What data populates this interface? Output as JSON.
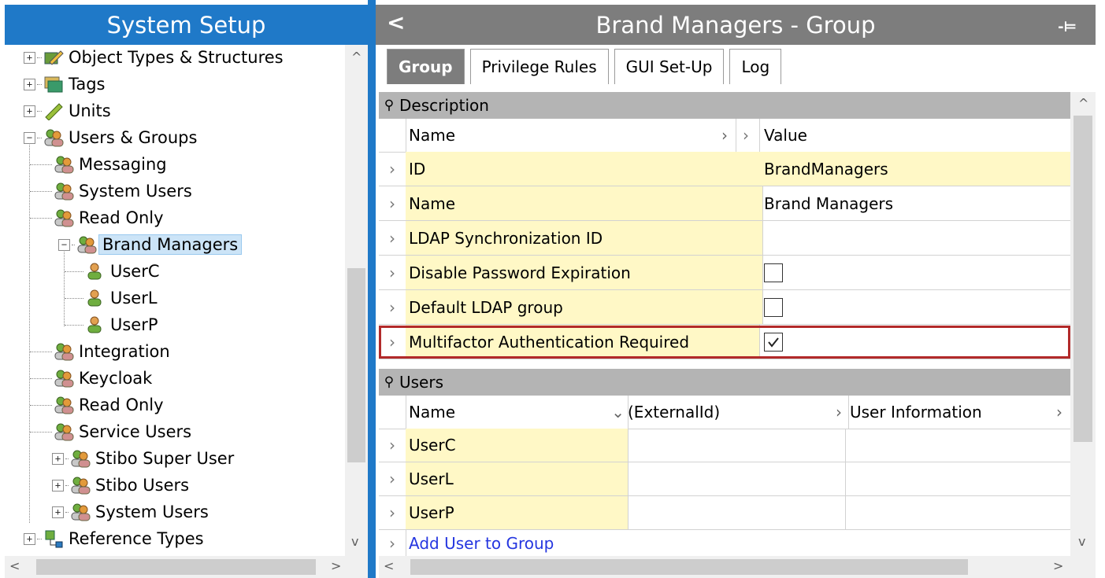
{
  "left_panel": {
    "title": "System Setup",
    "tree": [
      {
        "label": "Object Types & Structures",
        "expander": "+",
        "icon": "object-types-icon"
      },
      {
        "label": "Tags",
        "expander": "+",
        "icon": "tags-icon"
      },
      {
        "label": "Units",
        "expander": "+",
        "icon": "units-ruler-icon"
      },
      {
        "label": "Users & Groups",
        "expander": "-",
        "icon": "user-group-icon"
      },
      {
        "label": "Messaging",
        "icon": "user-group-icon"
      },
      {
        "label": "System Users",
        "icon": "user-group-icon"
      },
      {
        "label": "Read Only",
        "icon": "user-group-icon"
      },
      {
        "label": "Brand Managers",
        "expander": "-",
        "icon": "user-group-icon",
        "selected": true
      },
      {
        "label": "UserC",
        "icon": "user-icon"
      },
      {
        "label": "UserL",
        "icon": "user-icon"
      },
      {
        "label": "UserP",
        "icon": "user-icon"
      },
      {
        "label": "Integration",
        "icon": "user-group-icon"
      },
      {
        "label": "Keycloak",
        "icon": "user-group-icon"
      },
      {
        "label": "Read Only",
        "icon": "user-group-icon"
      },
      {
        "label": "Service Users",
        "icon": "user-group-icon"
      },
      {
        "label": "Stibo Super User",
        "expander": "+",
        "icon": "user-group-icon"
      },
      {
        "label": "Stibo Users",
        "expander": "+",
        "icon": "user-group-icon"
      },
      {
        "label": "System Users",
        "expander": "+",
        "icon": "user-group-icon"
      },
      {
        "label": "Reference Types",
        "expander": "+",
        "icon": "reference-types-icon"
      }
    ]
  },
  "right_panel": {
    "title": "Brand Managers - Group",
    "back_glyph": "<",
    "pin_glyph": "-⊨",
    "tabs": [
      {
        "label": "Group",
        "active": true
      },
      {
        "label": "Privilege Rules"
      },
      {
        "label": "GUI Set-Up"
      },
      {
        "label": "Log"
      }
    ],
    "description": {
      "section_title": "Description",
      "columns": {
        "name": "Name",
        "value": "Value"
      },
      "rows": [
        {
          "name": "ID",
          "value": "BrandManagers"
        },
        {
          "name": "Name",
          "value": "Brand Managers"
        },
        {
          "name": "LDAP Synchronization ID",
          "value": ""
        },
        {
          "name": "Disable Password Expiration",
          "checkbox": false
        },
        {
          "name": "Default LDAP group",
          "checkbox": false
        },
        {
          "name": "Multifactor Authentication Required",
          "checkbox": true
        }
      ]
    },
    "users": {
      "section_title": "Users",
      "columns": {
        "name": "Name",
        "external_id": "(ExternalId)",
        "user_info": "User Information"
      },
      "rows": [
        {
          "name": "UserC"
        },
        {
          "name": "UserL"
        },
        {
          "name": "UserP"
        }
      ],
      "add_link": "Add User to Group"
    }
  },
  "colors": {
    "left_header": "#1f79c8",
    "right_header": "#7d7d7d",
    "row_highlight": "#fff8c6",
    "annotation_border": "#b22a2a",
    "link": "#2536e0"
  }
}
